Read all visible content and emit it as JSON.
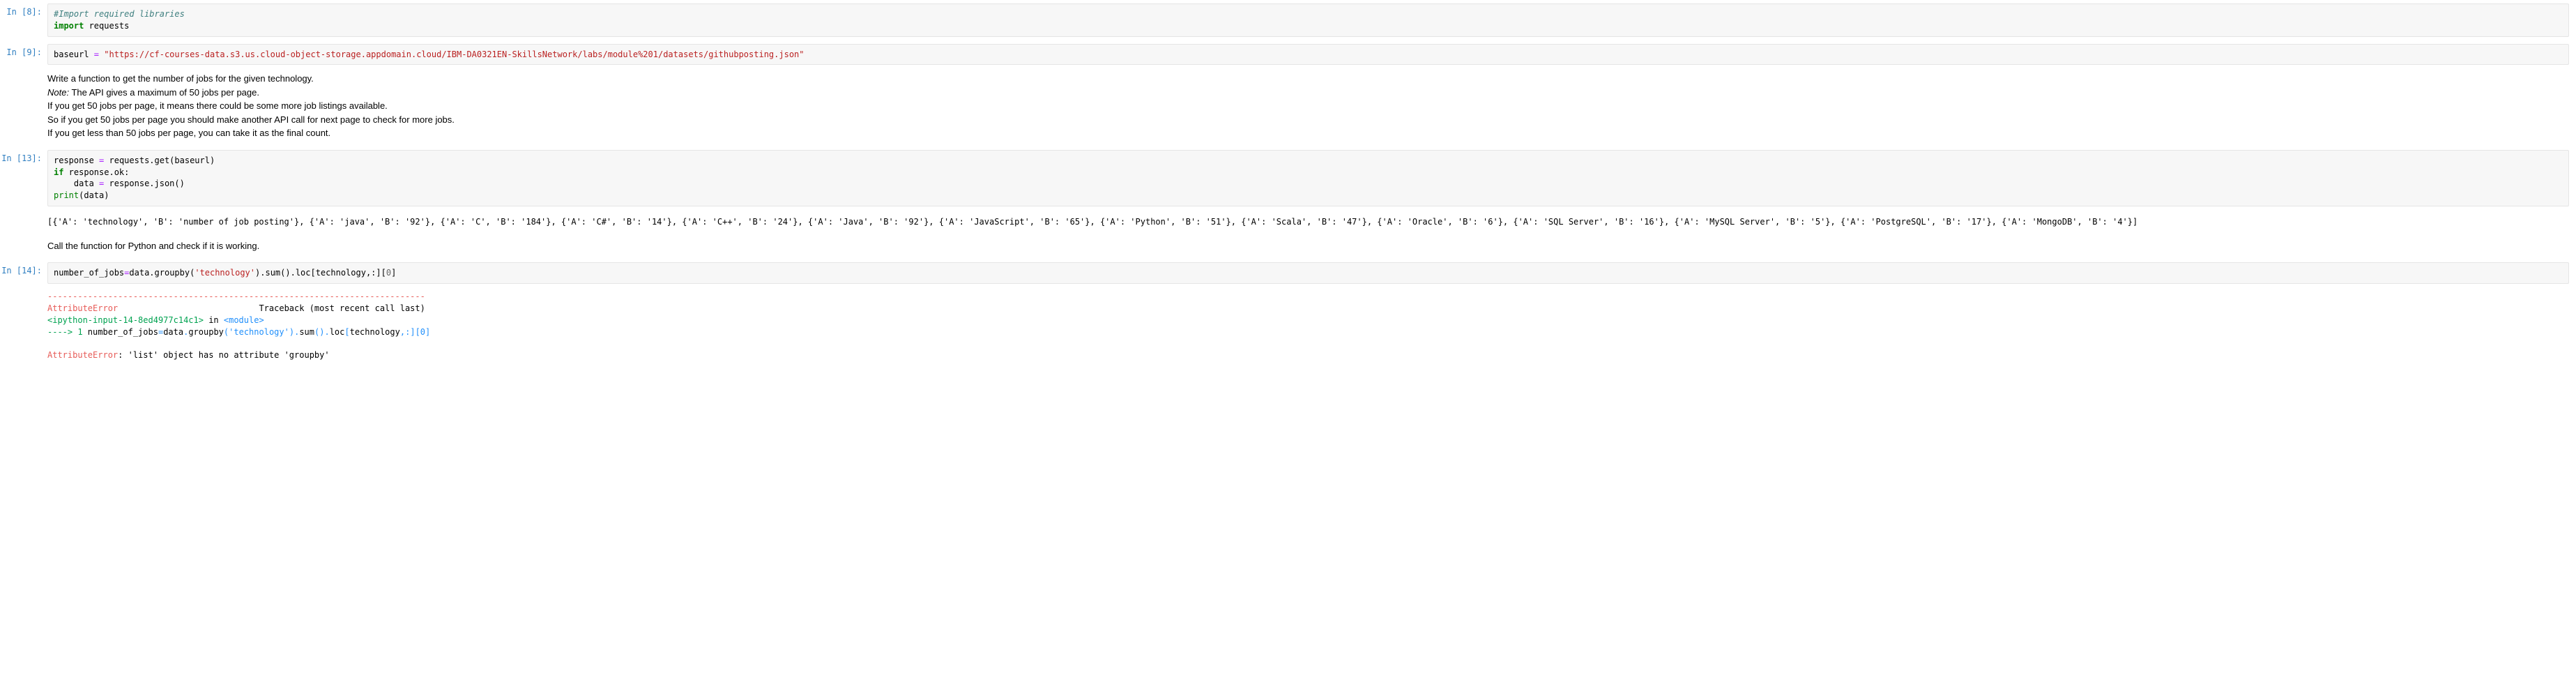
{
  "cells": {
    "cell8": {
      "prompt": "In [8]:",
      "code_html": "<span class=\"cm-comment\">#Import required libraries</span>\n<span class=\"cm-keyword\">import</span> requests"
    },
    "cell9": {
      "prompt": "In [9]:",
      "code_html": "baseurl <span class=\"cm-operator\">=</span> <span class=\"cm-string\">\"https://cf-courses-data.s3.us.cloud-object-storage.appdomain.cloud/IBM-DA0321EN-SkillsNetwork/labs/module%201/datasets/githubposting.json\"</span>"
    },
    "markdown1": {
      "html": "Write a function to get the number of jobs for the given technology.<br><em>Note:</em> The API gives a maximum of 50 jobs per page.<br>If you get 50 jobs per page, it means there could be some more job listings available.<br>So if you get 50 jobs per page you should make another API call for next page to check for more jobs.<br>If you get less than 50 jobs per page, you can take it as the final count."
    },
    "cell13": {
      "prompt": "In [13]:",
      "code_html": "response <span class=\"cm-operator\">=</span> requests.get(baseurl)\n<span class=\"cm-keyword\">if</span> response.ok:\n    data <span class=\"cm-operator\">=</span> response.json()\n<span class=\"cm-builtin\">print</span>(data)",
      "output": "[{'A': 'technology', 'B': 'number of job posting'}, {'A': 'java', 'B': '92'}, {'A': 'C', 'B': '184'}, {'A': 'C#', 'B': '14'}, {'A': 'C++', 'B': '24'}, {'A': 'Java', 'B': '92'}, {'A': 'JavaScript', 'B': '65'}, {'A': 'Python', 'B': '51'}, {'A': 'Scala', 'B': '47'}, {'A': 'Oracle', 'B': '6'}, {'A': 'SQL Server', 'B': '16'}, {'A': 'MySQL Server', 'B': '5'}, {'A': 'PostgreSQL', 'B': '17'}, {'A': 'MongoDB', 'B': '4'}]"
    },
    "markdown2": {
      "text": "Call the function for Python and check if it is working."
    },
    "cell14": {
      "prompt": "In [14]:",
      "code_html": "number_of_jobs<span class=\"cm-operator\">=</span>data.groupby(<span class=\"cm-string\">'technology'</span>).sum().loc[technology,:][<span class=\"cm-number\">0</span>]",
      "error_html": "<span class=\"err-sep\">---------------------------------------------------------------------------</span>\n<span class=\"err-red\">AttributeError</span>                            Traceback (most recent call last)\n<span class=\"err-green\">&lt;ipython-input-14-8ed4977c14c1&gt;</span> in <span class=\"err-cyan\">&lt;module&gt;</span>\n<span class=\"err-green\">----&gt; 1</span> number_of_jobs<span class=\"err-cyan\">=</span>data<span class=\"err-cyan\">.</span>groupby<span class=\"err-cyan\">(</span><span class=\"err-cyan\">'technology'</span><span class=\"err-cyan\">)</span><span class=\"err-cyan\">.</span>sum<span class=\"err-cyan\">()</span><span class=\"err-cyan\">.</span>loc<span class=\"err-cyan\">[</span>technology<span class=\"err-cyan\">,</span><span class=\"err-cyan\">:</span><span class=\"err-cyan\">]</span><span class=\"err-cyan\">[</span><span class=\"err-cyan\">0</span><span class=\"err-cyan\">]</span>\n\n<span class=\"err-red\">AttributeError</span>: 'list' object has no attribute 'groupby'"
    }
  }
}
